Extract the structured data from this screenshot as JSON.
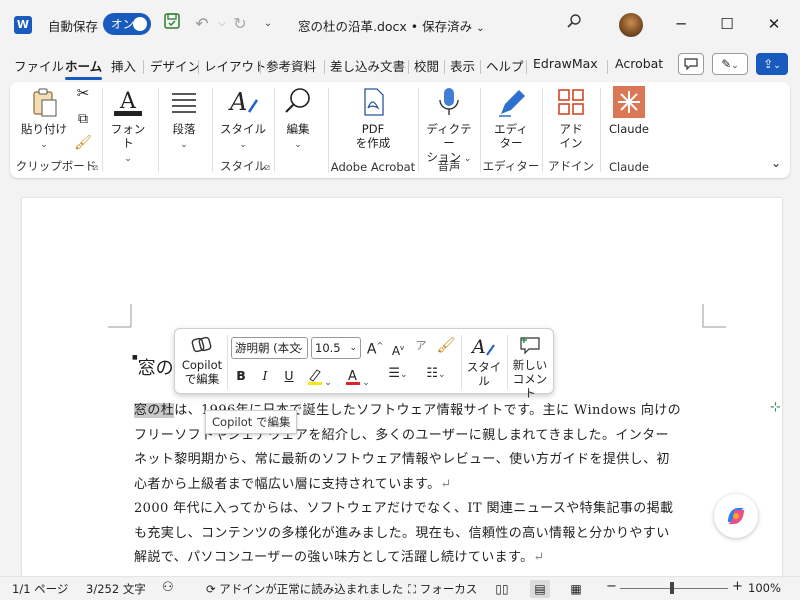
{
  "titlebar": {
    "app_icon": "W",
    "autosave_label": "自動保存",
    "autosave_state": "オン",
    "doc_title": "窓の杜の沿革.docx • 保存済み",
    "icons": [
      "save-icon",
      "undo-icon",
      "redo-icon",
      "customize-icon",
      "search-icon",
      "minimize-icon",
      "maximize-icon",
      "close-icon"
    ]
  },
  "tabs": [
    "ファイル",
    "ホーム",
    "挿入",
    "デザイン",
    "レイアウト",
    "参考資料",
    "差し込み文書",
    "校閲",
    "表示",
    "ヘルプ",
    "EdrawMax",
    "Acrobat"
  ],
  "active_tab": "ホーム",
  "ribbon": {
    "paste": "貼り付け",
    "clipboard_group": "クリップボード",
    "font": "フォント",
    "paragraph": "段落",
    "styles": "スタイル",
    "styles_group": "スタイル",
    "editing": "編集",
    "pdf_line1": "PDF",
    "pdf_line2": "を作成",
    "acrobat_group": "Adobe Acrobat",
    "dictate_line1": "ディクテー",
    "dictate_line2": "ション",
    "voice_group": "音声",
    "editor_line1": "エディ",
    "editor_line2": "ター",
    "editor_group": "エディター",
    "addin_line1": "アド",
    "addin_line2": "イン",
    "addin_group": "アドイン",
    "claude": "Claude",
    "claude_group": "Claude"
  },
  "document": {
    "heading": "窓の",
    "highlighted": "窓の杜",
    "para1_line1_rest": "は、1996年に日本で誕生したソフトウェア情報サイトです。主に Windows 向けの",
    "para1_line2": "フリーソフトやシェアウェアを紹介し、多くのユーザーに親しまれてきました。インター",
    "para1_line3": "ネット黎明期から、常に最新のソフトウェア情報やレビュー、使い方ガイドを提供し、初",
    "para1_line4": "心者から上級者まで幅広い層に支持されています。",
    "para2_line1": "2000 年代に入ってからは、ソフトウェアだけでなく、IT 関連ニュースや特集記事の掲載",
    "para2_line2": "も充実し、コンテンツの多様化が進みました。現在も、信頼性の高い情報と分かりやすい",
    "para2_line3": "解説で、パソコンユーザーの強い味方として活躍し続けています。",
    "return_mark": "↵"
  },
  "mini_toolbar": {
    "copilot_line1": "Copilot",
    "copilot_line2": "で編集",
    "font_name": "游明朝 (本文",
    "font_size": "10.5",
    "bold": "B",
    "italic": "I",
    "underline": "U",
    "style": "スタイル",
    "new_comment_line1": "新しい",
    "new_comment_line2": "コメント",
    "highlight_color": "#f6e71b",
    "font_color": "#e0202b"
  },
  "tooltip": "Copilot で編集",
  "statusbar": {
    "page": "1/1 ページ",
    "words": "3/252 文字",
    "addin_status": "アドインが正常に読み込まれました",
    "focus": "フォーカス",
    "zoom": "100%",
    "zoom_minus": "−",
    "zoom_plus": "+"
  }
}
